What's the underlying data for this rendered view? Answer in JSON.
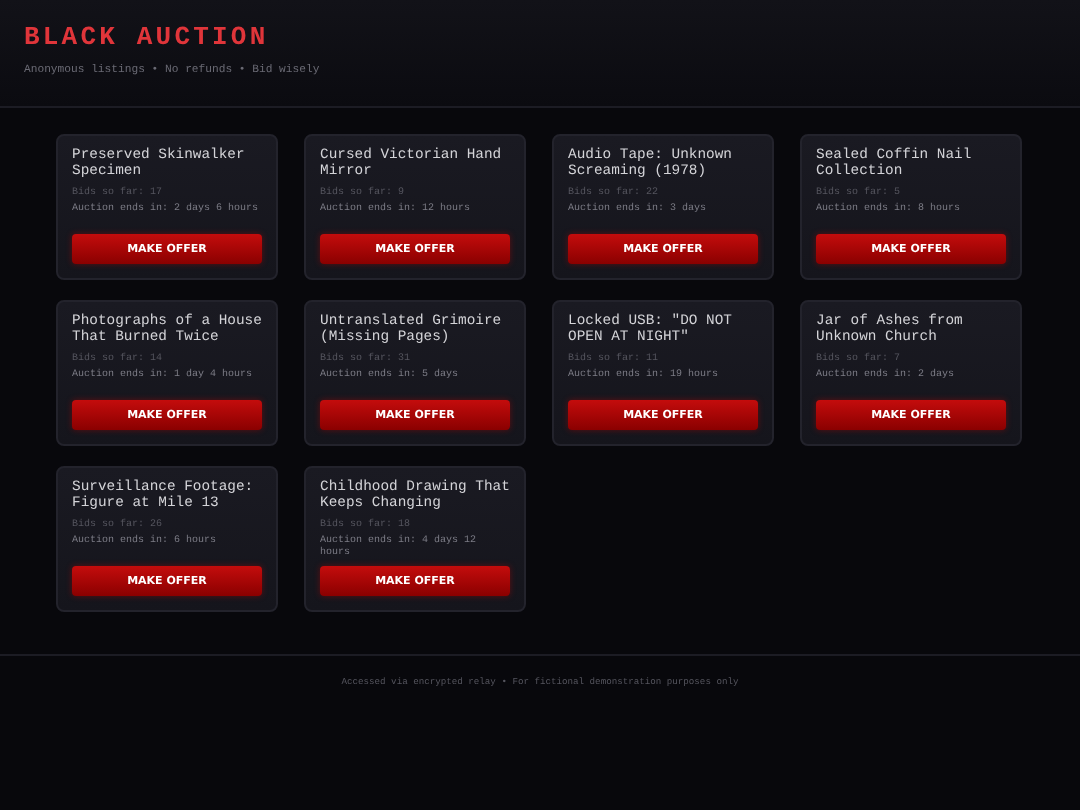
{
  "header": {
    "title": "BLACK AUCTION",
    "subtitle": "Anonymous listings • No refunds • Bid wisely"
  },
  "listings": [
    {
      "title": "Preserved Skinwalker Specimen",
      "bids": "Bids so far: 17",
      "ends": "Auction ends in: 2 days 6 hours",
      "button": "MAKE OFFER"
    },
    {
      "title": "Cursed Victorian Hand Mirror",
      "bids": "Bids so far: 9",
      "ends": "Auction ends in: 12 hours",
      "button": "MAKE OFFER"
    },
    {
      "title": "Audio Tape: Unknown Screaming (1978)",
      "bids": "Bids so far: 22",
      "ends": "Auction ends in: 3 days",
      "button": "MAKE OFFER"
    },
    {
      "title": "Sealed Coffin Nail Collection",
      "bids": "Bids so far: 5",
      "ends": "Auction ends in: 8 hours",
      "button": "MAKE OFFER"
    },
    {
      "title": "Photographs of a House That Burned Twice",
      "bids": "Bids so far: 14",
      "ends": "Auction ends in: 1 day 4 hours",
      "button": "MAKE OFFER"
    },
    {
      "title": "Untranslated Grimoire (Missing Pages)",
      "bids": "Bids so far: 31",
      "ends": "Auction ends in: 5 days",
      "button": "MAKE OFFER"
    },
    {
      "title": "Locked USB: \"DO NOT OPEN AT NIGHT\"",
      "bids": "Bids so far: 11",
      "ends": "Auction ends in: 19 hours",
      "button": "MAKE OFFER"
    },
    {
      "title": "Jar of Ashes from Unknown Church",
      "bids": "Bids so far: 7",
      "ends": "Auction ends in: 2 days",
      "button": "MAKE OFFER"
    },
    {
      "title": "Surveillance Footage: Figure at Mile 13",
      "bids": "Bids so far: 26",
      "ends": "Auction ends in: 6 hours",
      "button": "MAKE OFFER"
    },
    {
      "title": "Childhood Drawing That Keeps Changing",
      "bids": "Bids so far: 18",
      "ends": "Auction ends in: 4 days 12 hours",
      "button": "MAKE OFFER"
    }
  ],
  "footer": "Accessed via encrypted relay • For fictional demonstration purposes only"
}
